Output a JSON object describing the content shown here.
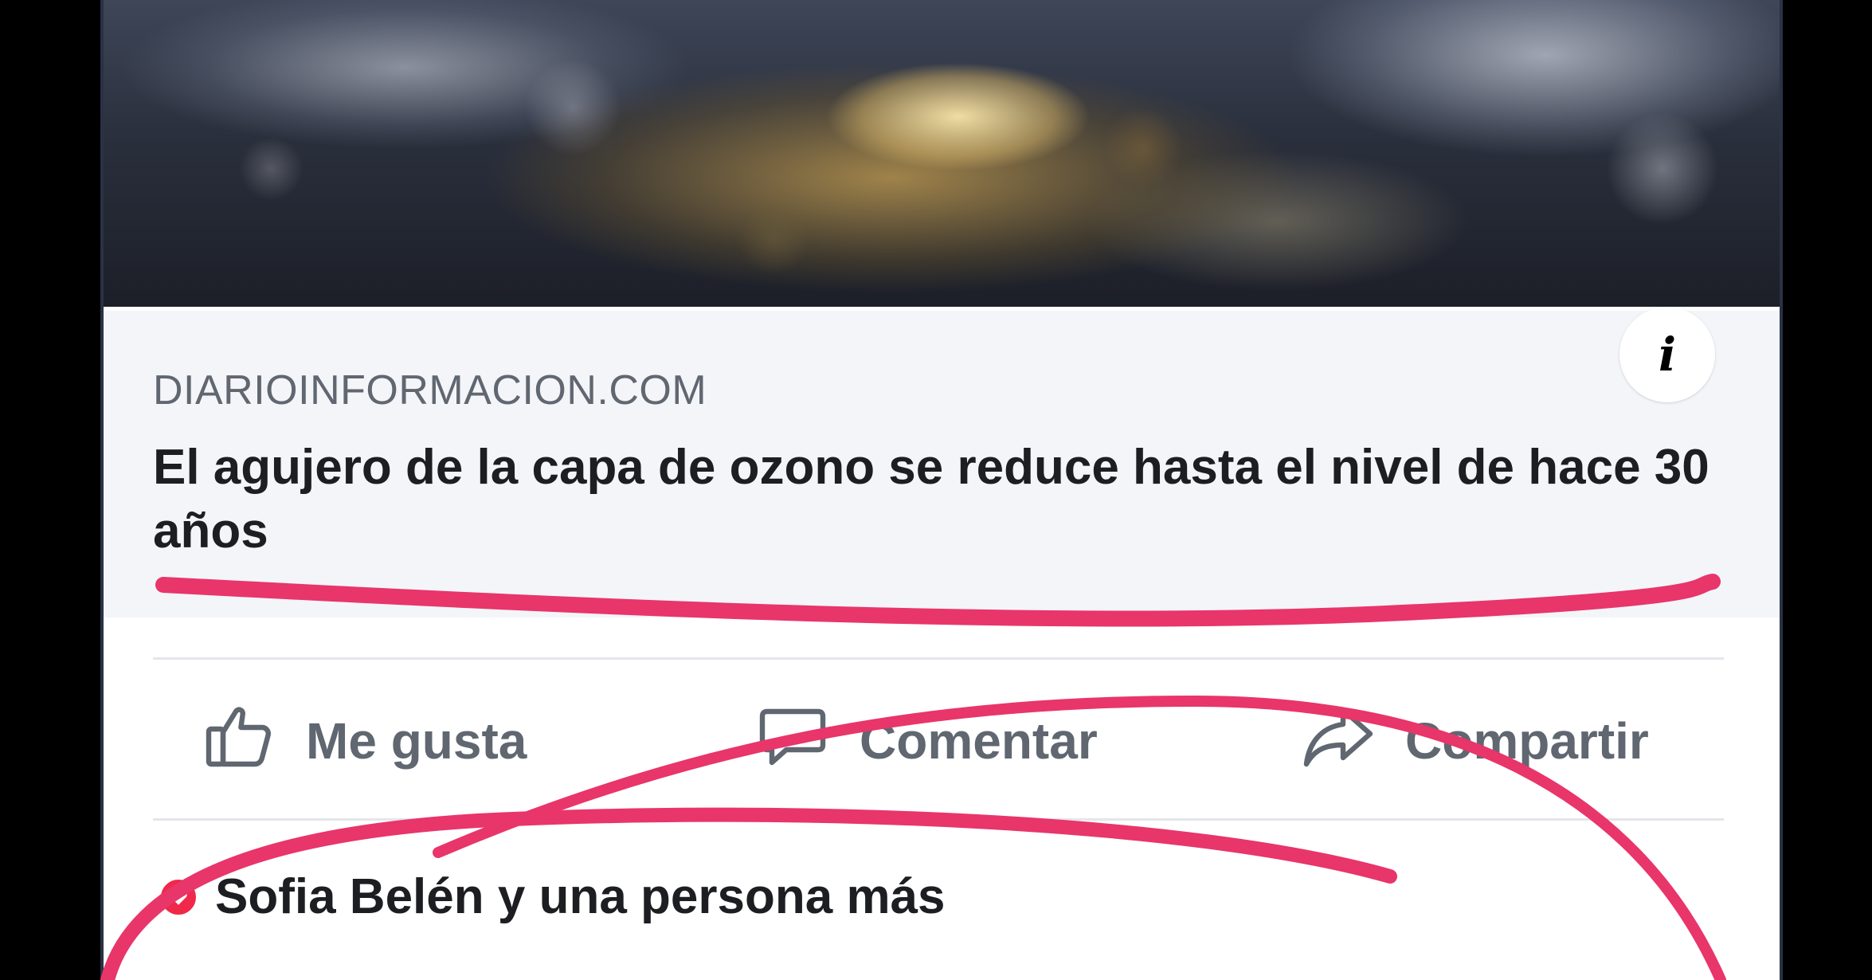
{
  "link_preview": {
    "source": "DIARIOINFORMACION.COM",
    "headline": "El agujero de la capa de ozono se reduce hasta el nivel de hace 30 años",
    "info_icon": "info-icon"
  },
  "actions": {
    "like_label": "Me gusta",
    "comment_label": "Comentar",
    "share_label": "Compartir",
    "like_icon": "thumbs-up-icon",
    "comment_icon": "speech-bubble-icon",
    "share_icon": "share-arrow-icon"
  },
  "reactions": {
    "summary": "Sofia Belén y una persona más",
    "icon": "love-reaction-icon"
  },
  "colors": {
    "annotation_stroke": "#e8356a",
    "action_text": "#606770",
    "reaction_love": "#f0284a"
  }
}
